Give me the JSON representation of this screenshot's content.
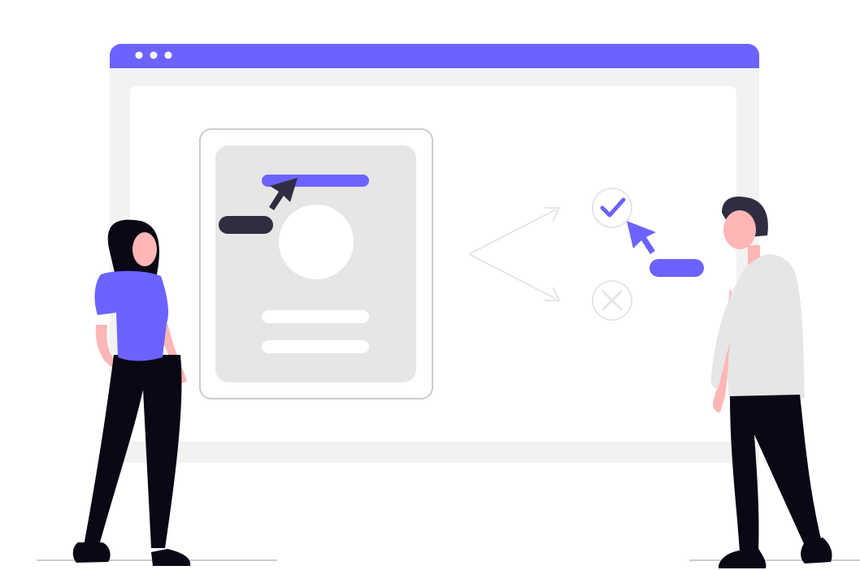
{
  "illustration": {
    "colors": {
      "accent": "#6c63ff",
      "frame": "#f2f2f2",
      "panel": "#e6e6e6",
      "outline": "#cccccc",
      "dark": "#2f2e41",
      "black": "#090814",
      "skin": "#ffb6b6",
      "shirt": "#e6e6e6",
      "arrow": "#e6e6e6"
    },
    "icons": [
      "browser-window-icon",
      "window-dots-icon",
      "profile-card-icon",
      "cursor-icon",
      "check-icon",
      "close-icon"
    ]
  }
}
